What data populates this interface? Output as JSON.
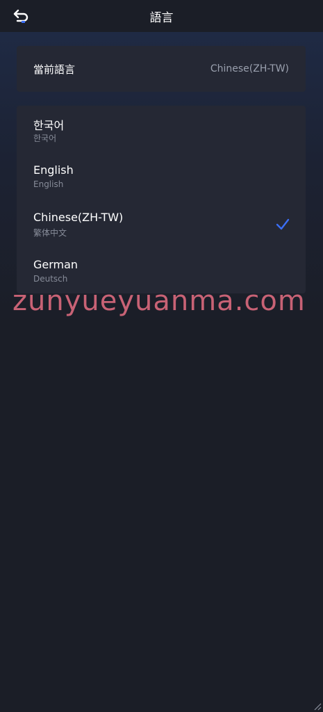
{
  "header": {
    "title": "語言",
    "back_icon": "back-arrow-icon"
  },
  "current": {
    "label": "當前語言",
    "value": "Chinese(ZH-TW)"
  },
  "languages": [
    {
      "name": "한국어",
      "native": "한국어",
      "selected": false
    },
    {
      "name": "English",
      "native": "English",
      "selected": false
    },
    {
      "name": "Chinese(ZH-TW)",
      "native": "繁体中文",
      "selected": true
    },
    {
      "name": "German",
      "native": "Deutsch",
      "selected": false
    }
  ],
  "watermark": "zunyueyuanma.com",
  "colors": {
    "accent": "#3b6ef5",
    "background": "#1b1e27",
    "card": "#252834"
  }
}
